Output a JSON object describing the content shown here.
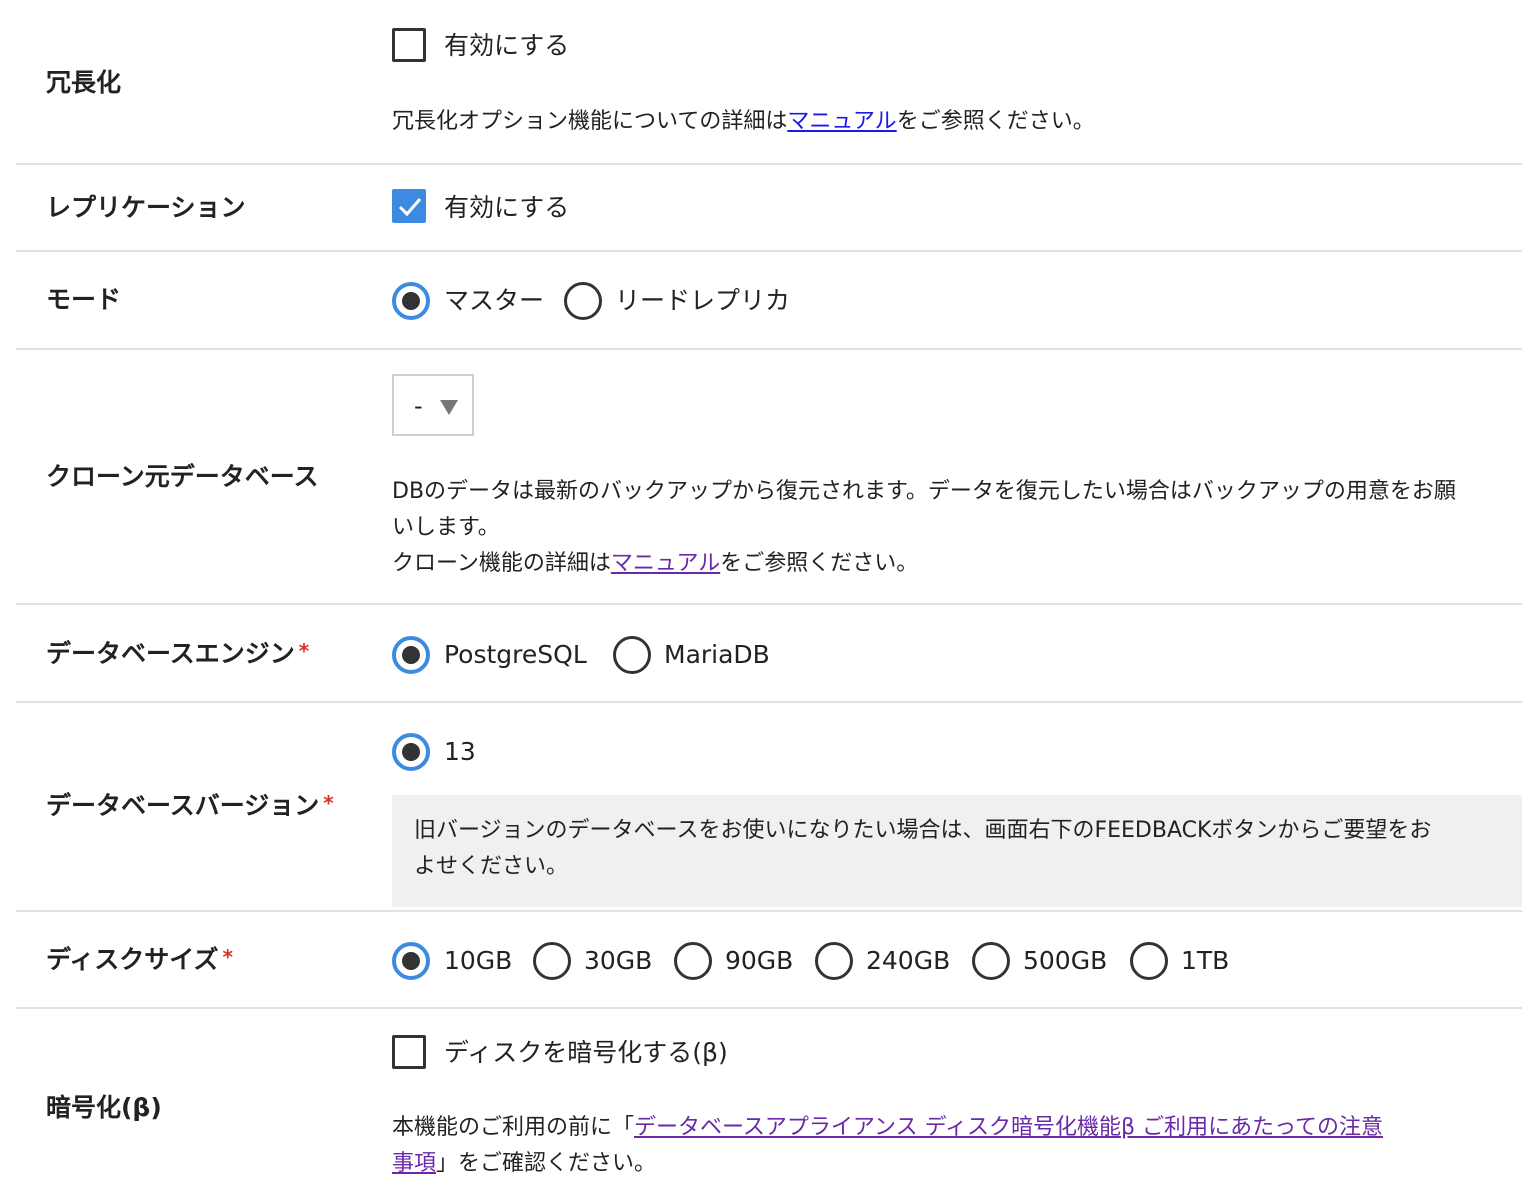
{
  "redundancy": {
    "label": "冗長化",
    "checkbox_label": "有効にする",
    "checked": false,
    "help_prefix": "冗長化オプション機能についての詳細は",
    "help_link": "マニュアル",
    "help_suffix": "をご参照ください。"
  },
  "replication": {
    "label": "レプリケーション",
    "checkbox_label": "有効にする",
    "checked": true
  },
  "mode": {
    "label": "モード",
    "options": [
      "マスター",
      "リードレプリカ"
    ],
    "selected": "マスター"
  },
  "clone_source": {
    "label": "クローン元データベース",
    "select_value": "-",
    "help_line1": "DBのデータは最新のバックアップから復元されます。データを復元したい場合はバックアップの用意をお願",
    "help_line2": "いします。",
    "help_line3_prefix": "クローン機能の詳細は",
    "help_link": "マニュアル",
    "help_line3_suffix": "をご参照ください。"
  },
  "engine": {
    "label": "データベースエンジン",
    "required_mark": "*",
    "options": [
      "PostgreSQL",
      "MariaDB"
    ],
    "selected": "PostgreSQL"
  },
  "version": {
    "label": "データベースバージョン",
    "required_mark": "*",
    "options": [
      "13"
    ],
    "selected": "13",
    "notice_line1": "旧バージョンのデータベースをお使いになりたい場合は、画面右下のFEEDBACKボタンからご要望をお",
    "notice_line2": "よせください。"
  },
  "disk_size": {
    "label": "ディスクサイズ",
    "required_mark": "*",
    "options": [
      "10GB",
      "30GB",
      "90GB",
      "240GB",
      "500GB",
      "1TB"
    ],
    "selected": "10GB"
  },
  "encryption": {
    "label": "暗号化(β)",
    "checkbox_label": "ディスクを暗号化する(β)",
    "checked": false,
    "help_prefix": "本機能のご利用の前に「",
    "help_link_part1": "データベースアプライアンス ディスク暗号化機能β ご利用にあたっての注意",
    "help_link_part2": "事項",
    "help_suffix": "」をご確認ください。"
  },
  "colors": {
    "accent": "#3d8be0",
    "link": "#1a1ae6",
    "visited_link": "#6a2aa8",
    "required": "#d93025",
    "notice_bg": "#f0f0f0"
  }
}
